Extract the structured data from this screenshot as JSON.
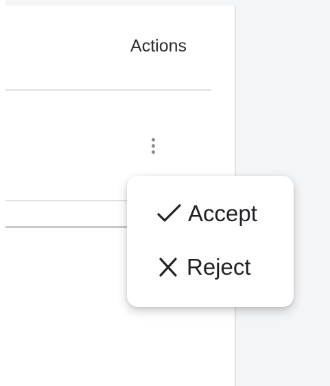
{
  "table": {
    "header": {
      "actions_label": "Actions"
    }
  },
  "row_menu": {
    "trigger_icon": "more-vertical-icon",
    "items": [
      {
        "label": "Accept",
        "icon": "check-icon"
      },
      {
        "label": "Reject",
        "icon": "close-icon"
      }
    ]
  },
  "colors": {
    "page_bg": "#f4f5f7",
    "card_bg": "#ffffff",
    "divider": "#e0e0e0",
    "text": "#1f2124",
    "menu_shadow": "rgba(0,0,0,0.18)"
  }
}
